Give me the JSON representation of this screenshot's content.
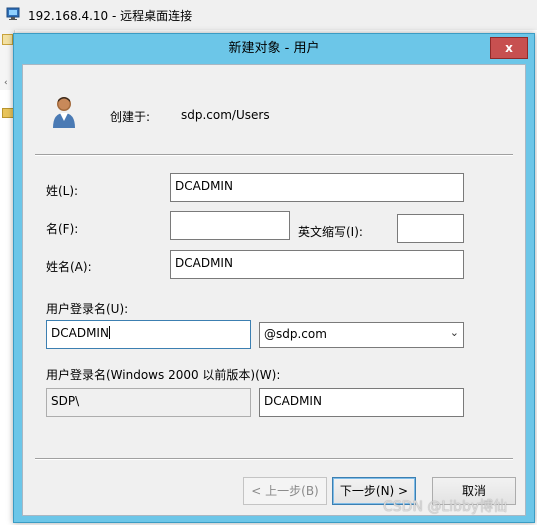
{
  "rdp": {
    "title": "192.168.4.10 - 远程桌面连接"
  },
  "dialog": {
    "title": "新建对象 - 用户",
    "close": "x",
    "created_label": "创建于:",
    "created_value": "sdp.com/Users"
  },
  "form": {
    "last_name_label": "姓(L):",
    "last_name_value": "DCADMIN",
    "first_name_label": "名(F):",
    "first_name_value": "",
    "initials_label": "英文缩写(I):",
    "initials_value": "",
    "full_name_label": "姓名(A):",
    "full_name_value": "DCADMIN",
    "logon_label": "用户登录名(U):",
    "logon_value": "DCADMIN",
    "domain_value": "@sdp.com",
    "pre2000_label": "用户登录名(Windows 2000 以前版本)(W):",
    "pre2000_domain": "SDP\\",
    "pre2000_value": "DCADMIN"
  },
  "buttons": {
    "back": "< 上一步(B)",
    "next": "下一步(N) >",
    "cancel": "取消"
  },
  "watermark": "CSDN @Libby博仙"
}
